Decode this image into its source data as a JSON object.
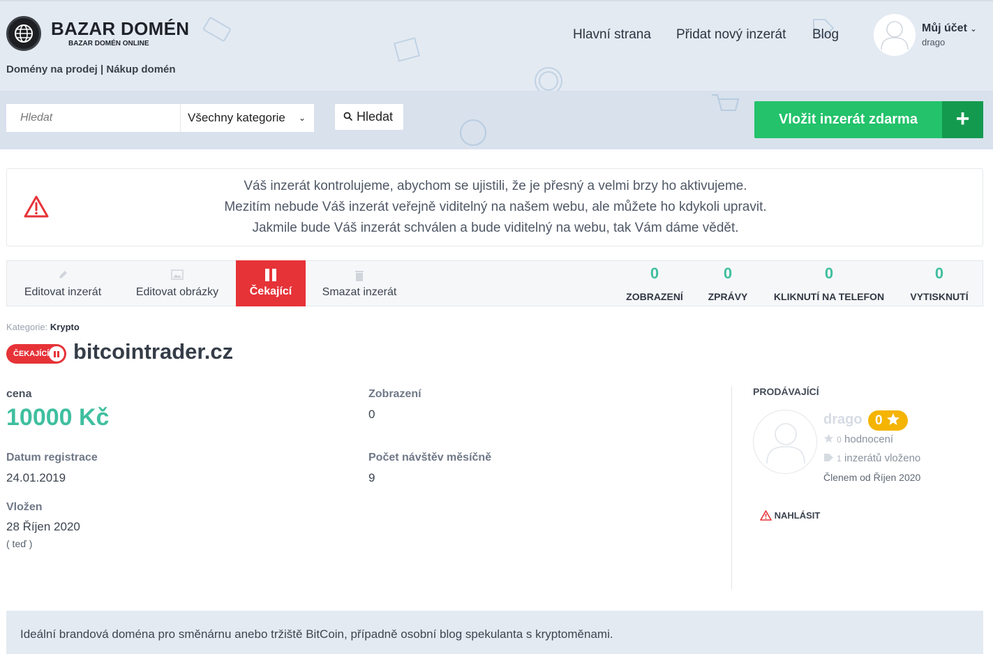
{
  "brand": {
    "title": "BAZAR DOMÉN",
    "subtitle": "BAZAR DOMÉN ONLINE",
    "tagline": "Domény na prodej | Nákup domén"
  },
  "nav": {
    "home": "Hlavní strana",
    "add": "Přidat nový inzerát",
    "blog": "Blog",
    "account_label": "Můj účet",
    "account_user": "drago"
  },
  "search": {
    "placeholder": "Hledat",
    "category": "Všechny kategorie",
    "button": "Hledat"
  },
  "cta": {
    "label": "Vložit inzerát zdarma",
    "plus": "+"
  },
  "notice": {
    "line1": "Váš inzerát kontrolujeme, abychom se ujistili, že je přesný a velmi brzy ho aktivujeme.",
    "line2": "Mezitím nebude Váš inzerát veřejně viditelný na našem webu, ale můžete ho kdykoli upravit.",
    "line3": "Jakmile bude Váš inzerát schválen a bude viditelný na webu, tak Vám dáme vědět."
  },
  "actions": {
    "edit": "Editovat inzerát",
    "images": "Editovat obrázky",
    "pending": "Čekající",
    "delete": "Smazat inzerát"
  },
  "stats": [
    {
      "value": "0",
      "label": "ZOBRAZENÍ"
    },
    {
      "value": "0",
      "label": "ZPRÁVY"
    },
    {
      "value": "0",
      "label": "KLIKNUTÍ NA TELEFON"
    },
    {
      "value": "0",
      "label": "VYTISKNUTÍ"
    }
  ],
  "listing": {
    "category_label": "Kategorie:",
    "category": "Krypto",
    "status": "ČEKAJÍCÍ",
    "domain": "bitcointrader.cz",
    "price_label": "cena",
    "price": "10000 Kč",
    "views_label": "Zobrazení",
    "views": "0",
    "reg_label": "Datum registrace",
    "reg": "24.01.2019",
    "visits_label": "Počet návštěv měsíčně",
    "visits": "9",
    "posted_label": "Vložen",
    "posted": "28 Říjen 2020",
    "posted_ago": "( teď )"
  },
  "seller": {
    "heading": "PRODÁVAJÍCÍ",
    "name": "drago",
    "rating": "0",
    "reviews_count": "0",
    "reviews_label": "hodnocení",
    "ads_count": "1",
    "ads_label": "inzerátů vloženo",
    "member_since": "Členem od Říjen 2020",
    "report": "NAHLÁSIT"
  },
  "description": "Ideální brandová doména pro směnárnu anebo tržiště BitCoin, případně osobní blog spekulanta s kryptoměnami.",
  "colors": {
    "accent_green": "#23c26b",
    "status_red": "#e63338",
    "stat_teal": "#3fbf9f",
    "rating_gold": "#f4b400"
  }
}
